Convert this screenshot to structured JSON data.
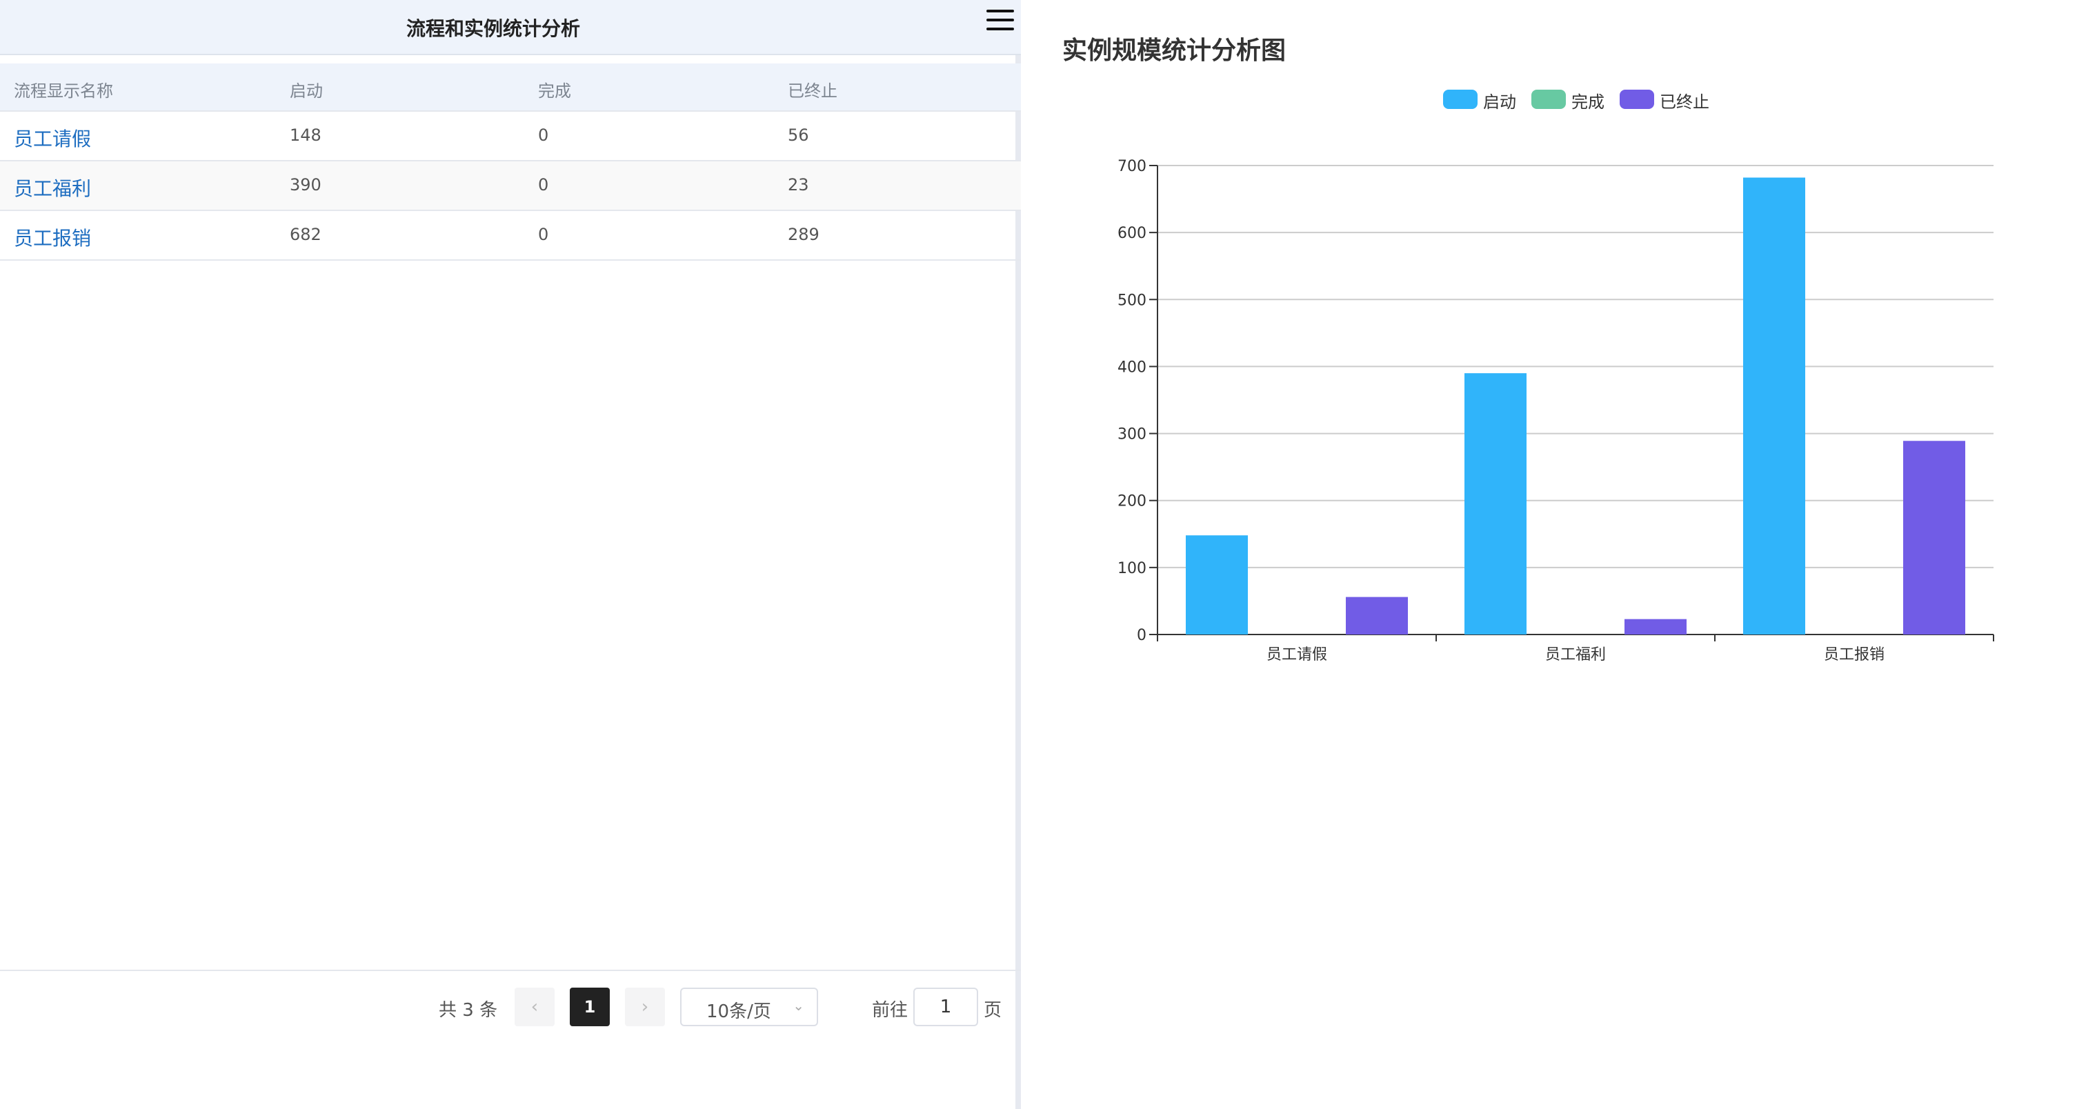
{
  "left_panel": {
    "title": "流程和实例统计分析",
    "menu_icon": "hamburger-menu-icon",
    "table": {
      "headers": [
        "流程显示名称",
        "启动",
        "完成",
        "已终止"
      ],
      "rows": [
        {
          "name": "员工请假",
          "started": "148",
          "completed": "0",
          "terminated": "56"
        },
        {
          "name": "员工福利",
          "started": "390",
          "completed": "0",
          "terminated": "23"
        },
        {
          "name": "员工报销",
          "started": "682",
          "completed": "0",
          "terminated": "289"
        }
      ]
    },
    "pagination": {
      "total_text": "共 3 条",
      "prev_icon": "chevron-left-icon",
      "current_page": "1",
      "next_icon": "chevron-right-icon",
      "page_size": "10条/页",
      "goto_prefix": "前往",
      "goto_value": "1",
      "goto_suffix": "页"
    }
  },
  "chart_panel": {
    "title": "实例规模统计分析图"
  },
  "chart_data": {
    "type": "bar",
    "title": "实例规模统计分析图",
    "categories": [
      "员工请假",
      "员工福利",
      "员工报销"
    ],
    "series": [
      {
        "name": "启动",
        "values": [
          148,
          390,
          682
        ],
        "color": "#30b4fa"
      },
      {
        "name": "完成",
        "values": [
          0,
          0,
          0
        ],
        "color": "#67c9a2"
      },
      {
        "name": "已终止",
        "values": [
          56,
          23,
          289
        ],
        "color": "#715ce6"
      }
    ],
    "yticks": [
      "0",
      "100",
      "200",
      "300",
      "400",
      "500",
      "600",
      "700"
    ],
    "ylim": [
      0,
      700
    ],
    "grid": true,
    "legend_position": "top-center"
  },
  "colors": {
    "accent_link": "#1d6dc0",
    "header_bg": "#eef3fb",
    "active_page": "#222222"
  }
}
